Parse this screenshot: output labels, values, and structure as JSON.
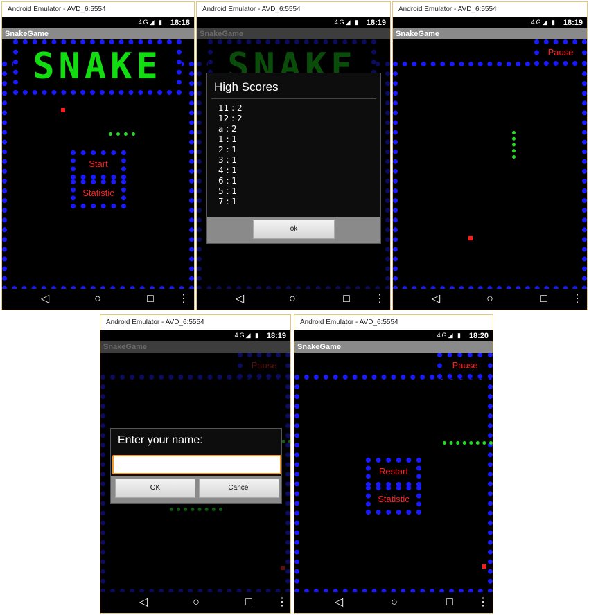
{
  "windows": [
    {
      "title": "Android Emulator - AVD_6:5554",
      "time": "18:18",
      "app_title": "SnakeGame"
    },
    {
      "title": "Android Emulator - AVD_6:5554",
      "time": "18:19",
      "app_title": "SnakeGame"
    },
    {
      "title": "Android Emulator - AVD_6:5554",
      "time": "18:19",
      "app_title": "SnakeGame"
    },
    {
      "title": "Android Emulator - AVD_6:5554",
      "time": "18:19",
      "app_title": "SnakeGame"
    },
    {
      "title": "Android Emulator - AVD_6:5554",
      "time": "18:20",
      "app_title": "SnakeGame"
    }
  ],
  "status_icons": "4G◢ ▮",
  "nav": {
    "back": "◁",
    "home": "○",
    "recents": "□",
    "menu": "⋮"
  },
  "menu": {
    "logo": "SNAKE",
    "start": "Start",
    "statistic": "Statistic"
  },
  "high_scores": {
    "title": "High Scores",
    "entries": [
      "11 : 2",
      "12 : 2",
      "a : 2",
      "1 : 1",
      "2 : 1",
      "3 : 1",
      "4 : 1",
      "6 : 1",
      "5 : 1",
      "7 : 1"
    ],
    "ok": "ok"
  },
  "game": {
    "pause": "Pause"
  },
  "name_dialog": {
    "title": "Enter your name:",
    "value": "",
    "ok": "OK",
    "cancel": "Cancel"
  },
  "game_over": {
    "restart": "Restart",
    "statistic": "Statistic",
    "pause": "Pause"
  },
  "colors": {
    "border": "#1a1aff",
    "snake": "#22dd22",
    "food": "#ff1a1a",
    "label": "#ff2020",
    "input_focus": "#f39b2a"
  }
}
